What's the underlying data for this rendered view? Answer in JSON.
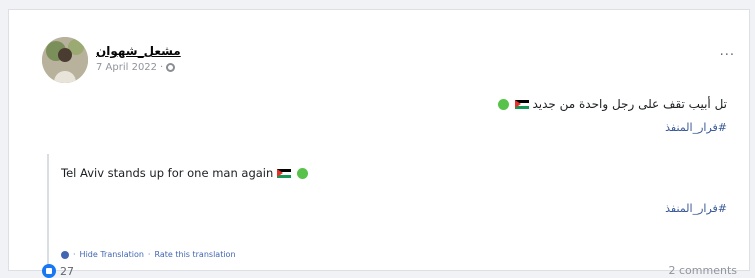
{
  "post": {
    "author": "مشعل_شهوان",
    "date": "7 April 2022",
    "original_text": "تل أبيب تقف على رجل واحدة من جديد",
    "hashtag": "#فرار_المنفذ",
    "translation_text": "Tel Aviv stands up for one man again",
    "translation_hashtag": "#فرار_المنفذ",
    "hide_translation": "Hide Translation",
    "rate_translation": "Rate this translation",
    "separator": "·",
    "reaction_count": "27",
    "comments": "2 comments",
    "more_label": "..."
  },
  "icons": {
    "avatar": "profile-photo",
    "privacy": "globe-icon",
    "flag": "palestine-flag-emoji",
    "heart": "green-heart-emoji",
    "reaction": "like-icon",
    "translate": "translate-icon"
  },
  "colors": {
    "link": "#385898",
    "like": "#1877f2",
    "heart": "#59c24a"
  }
}
